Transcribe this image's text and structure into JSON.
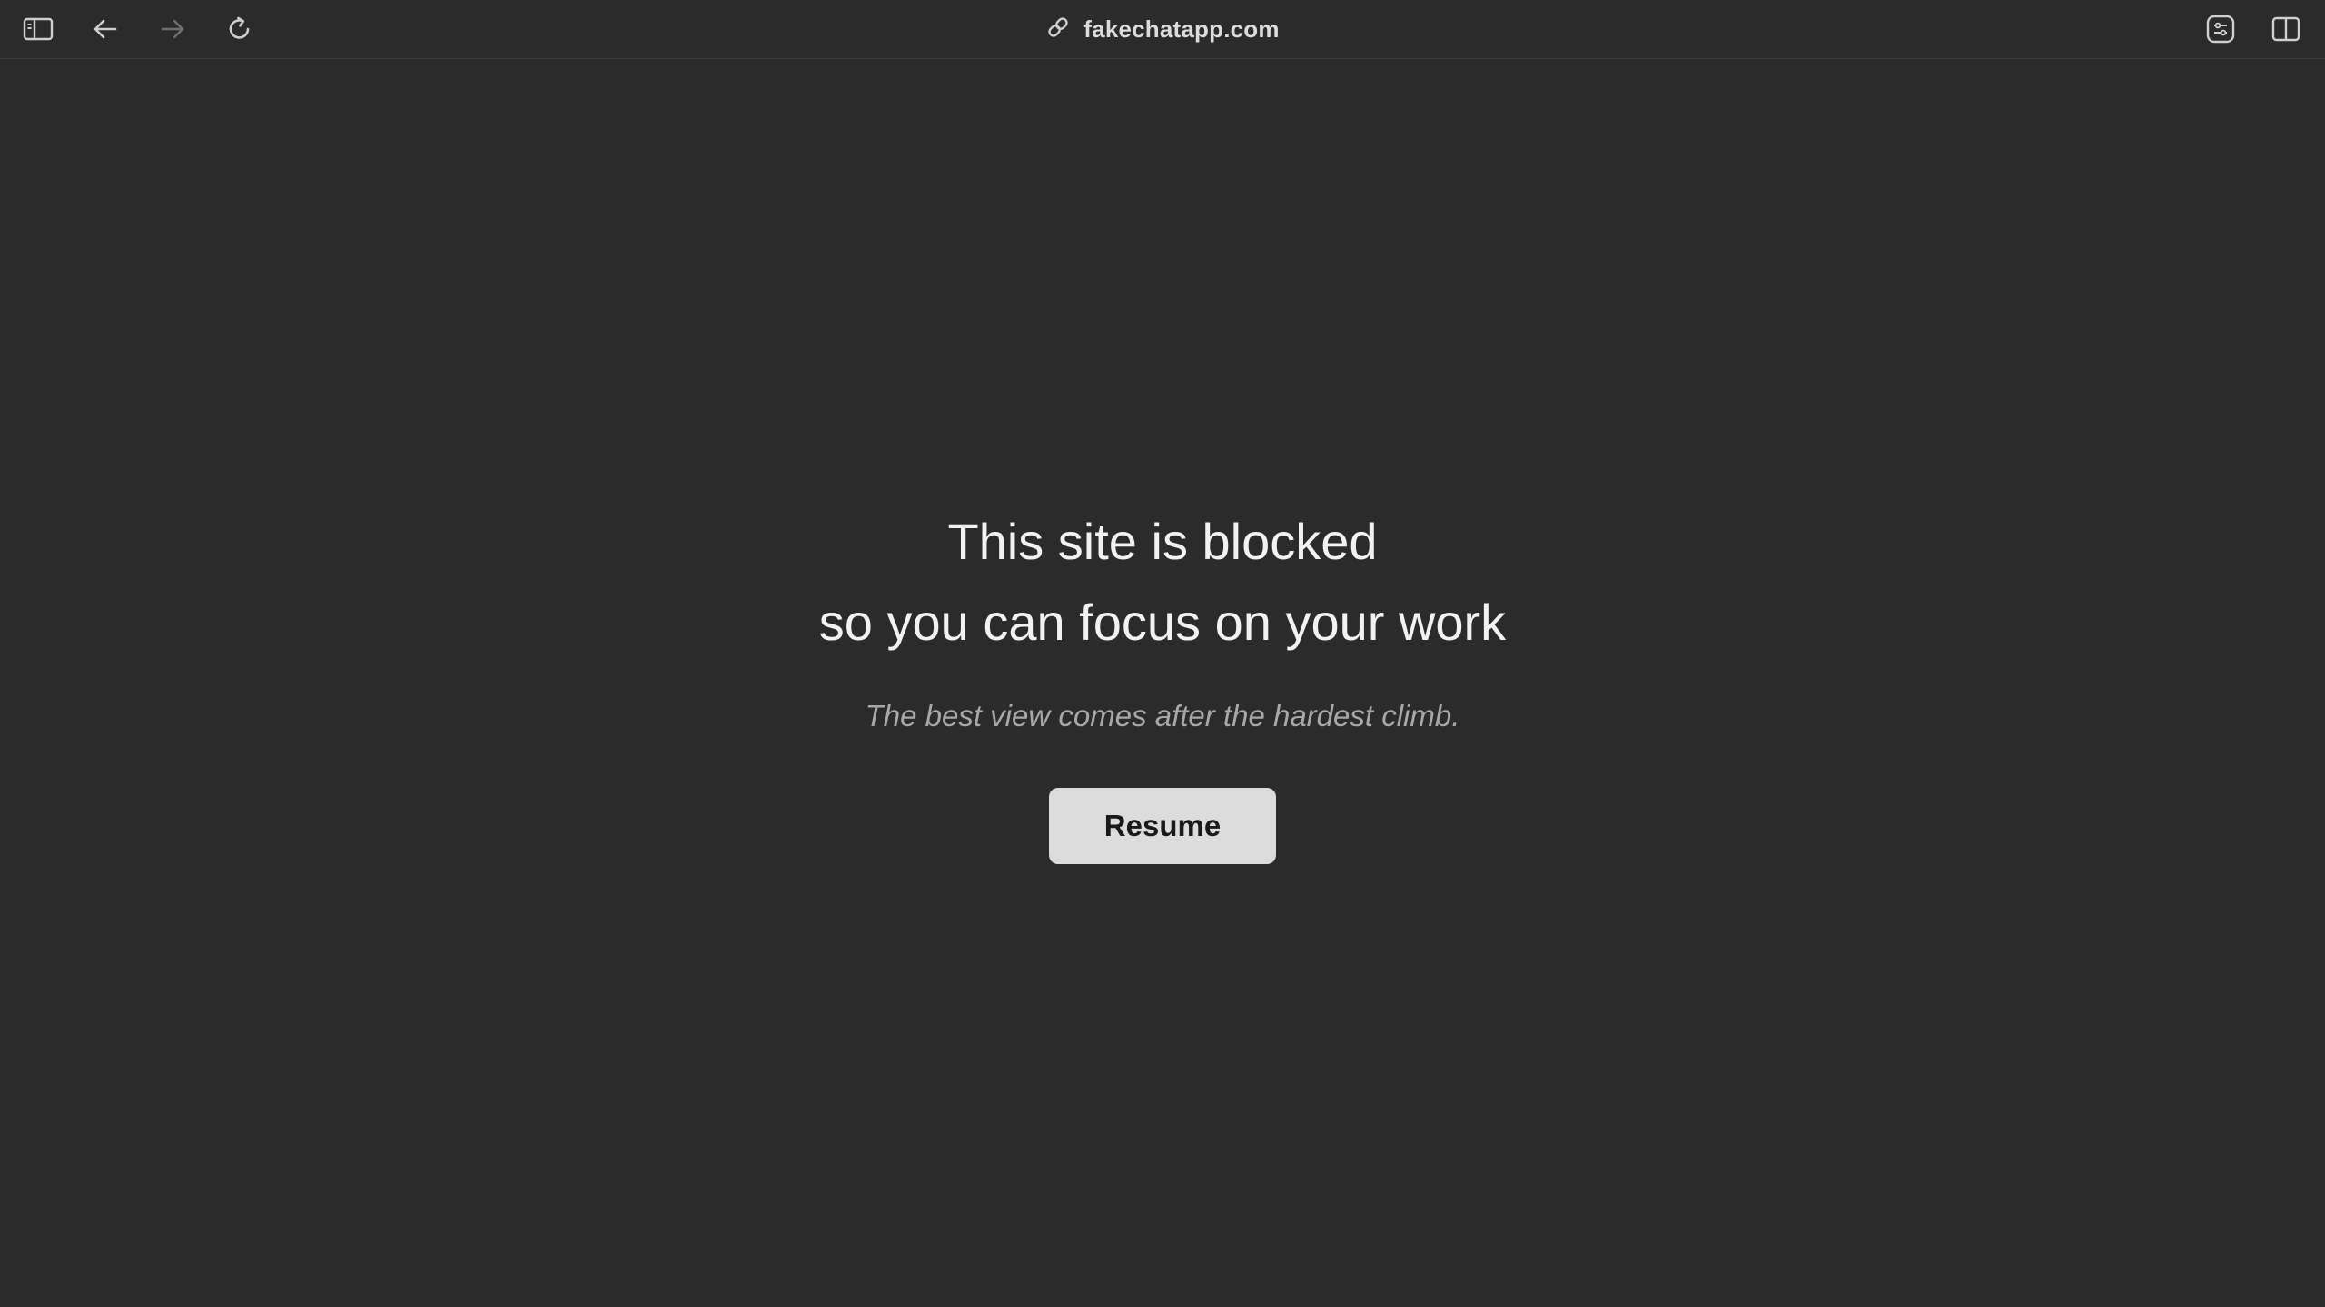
{
  "toolbar": {
    "sidebar_icon": "sidebar-icon",
    "back_icon": "arrow-left-icon",
    "forward_icon": "arrow-right-icon",
    "reload_icon": "reload-icon",
    "address_icon": "link-icon",
    "address_text": "fakechatapp.com",
    "extension_icon": "sliders-icon",
    "split_view_icon": "split-view-icon"
  },
  "page": {
    "headline_line1": "This site is blocked",
    "headline_line2": "so you can focus on your work",
    "quote": "The best view comes after the hardest climb.",
    "resume_label": "Resume"
  },
  "colors": {
    "background": "#2b2b2b",
    "button_bg": "#dcdcdc",
    "headline": "#f2f2f2",
    "quote": "#a8a8a8"
  }
}
